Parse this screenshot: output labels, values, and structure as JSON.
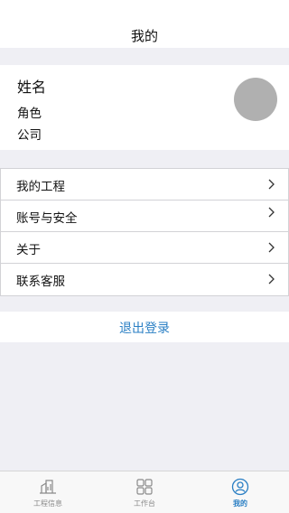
{
  "header": {
    "title": "我的"
  },
  "profile": {
    "name": "姓名",
    "role": "角色",
    "company": "公司"
  },
  "menu": {
    "items": [
      {
        "label": "我的工程"
      },
      {
        "label": "账号与安全"
      },
      {
        "label": "关于"
      },
      {
        "label": "联系客服"
      }
    ]
  },
  "logout": {
    "label": "退出登录"
  },
  "tabbar": {
    "tabs": [
      {
        "label": "工程信息",
        "icon": "building-chart-icon",
        "active": false
      },
      {
        "label": "工作台",
        "icon": "grid-icon",
        "active": false
      },
      {
        "label": "我的",
        "icon": "person-icon",
        "active": true
      }
    ]
  },
  "colors": {
    "accent": "#2a7fc4",
    "background": "#efeff4",
    "avatar": "#b0b0b0"
  }
}
